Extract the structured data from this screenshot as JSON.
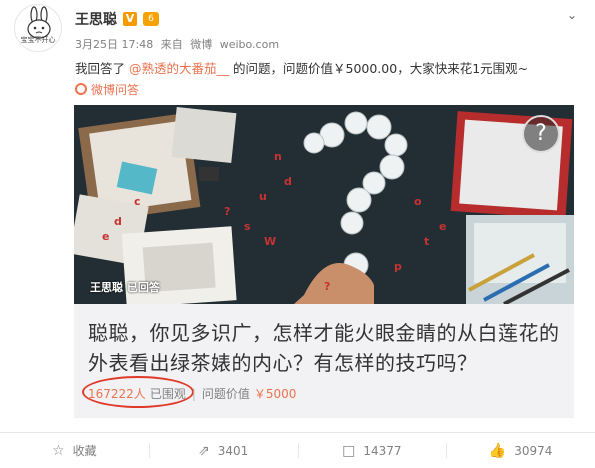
{
  "post": {
    "user_name": "王思聪",
    "vip_badge": "V",
    "level_badge": "6",
    "avatar_caption": "宝宝不开心",
    "timestamp": "3月25日 17:48",
    "source_prefix": "来自",
    "source_app": "微博",
    "source_site": "weibo.com",
    "text_before": "我回答了",
    "mention": "@熟透的大番茄__",
    "text_after": "的问题，问题价值￥5000.00，大家快来花1元围观~",
    "link_label": "微博问答"
  },
  "question": {
    "answered_caption": "王思聪 已回答",
    "title": "聪聪，你见多识广，怎样才能火眼金睛的从白莲花的外表看出绿茶婊的内心？有怎样的技巧吗？",
    "views_count": "167222人",
    "views_suffix": "已围观",
    "separator": "|",
    "price_prefix": "问题价值",
    "price": "￥5000",
    "image_glyph": "?"
  },
  "footer": {
    "favorite": "收藏",
    "repost": "3401",
    "comments": "14377",
    "likes": "30974"
  },
  "colors": {
    "accent": "#eb7350",
    "circle": "#e03b2a"
  }
}
